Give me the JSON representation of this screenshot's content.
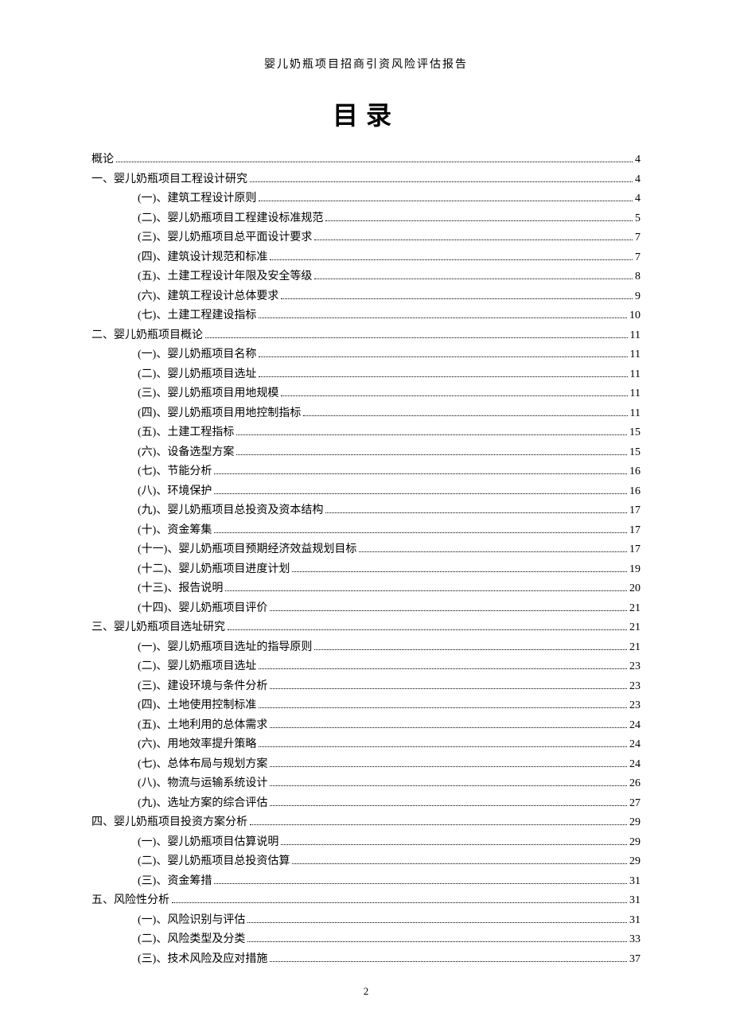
{
  "header": "婴儿奶瓶项目招商引资风险评估报告",
  "title": "目录",
  "page_number": "2",
  "toc": [
    {
      "level": 0,
      "label": "概论",
      "page": "4"
    },
    {
      "level": 1,
      "label": "一、婴儿奶瓶项目工程设计研究",
      "page": "4"
    },
    {
      "level": 2,
      "label": "(一)、建筑工程设计原则",
      "page": "4"
    },
    {
      "level": 2,
      "label": "(二)、婴儿奶瓶项目工程建设标准规范",
      "page": "5"
    },
    {
      "level": 2,
      "label": "(三)、婴儿奶瓶项目总平面设计要求",
      "page": "7"
    },
    {
      "level": 2,
      "label": "(四)、建筑设计规范和标准",
      "page": "7"
    },
    {
      "level": 2,
      "label": "(五)、土建工程设计年限及安全等级",
      "page": "8"
    },
    {
      "level": 2,
      "label": "(六)、建筑工程设计总体要求",
      "page": "9"
    },
    {
      "level": 2,
      "label": "(七)、土建工程建设指标",
      "page": "10"
    },
    {
      "level": 1,
      "label": "二、婴儿奶瓶项目概论",
      "page": "11"
    },
    {
      "level": 2,
      "label": "(一)、婴儿奶瓶项目名称",
      "page": "11"
    },
    {
      "level": 2,
      "label": "(二)、婴儿奶瓶项目选址",
      "page": "11"
    },
    {
      "level": 2,
      "label": "(三)、婴儿奶瓶项目用地规模",
      "page": "11"
    },
    {
      "level": 2,
      "label": "(四)、婴儿奶瓶项目用地控制指标",
      "page": "11"
    },
    {
      "level": 2,
      "label": "(五)、土建工程指标",
      "page": "15"
    },
    {
      "level": 2,
      "label": "(六)、设备选型方案",
      "page": "15"
    },
    {
      "level": 2,
      "label": "(七)、节能分析",
      "page": "16"
    },
    {
      "level": 2,
      "label": "(八)、环境保护",
      "page": "16"
    },
    {
      "level": 2,
      "label": "(九)、婴儿奶瓶项目总投资及资本结构",
      "page": "17"
    },
    {
      "level": 2,
      "label": "(十)、资金筹集",
      "page": "17"
    },
    {
      "level": 2,
      "label": "(十一)、婴儿奶瓶项目预期经济效益规划目标",
      "page": "17"
    },
    {
      "level": 2,
      "label": "(十二)、婴儿奶瓶项目进度计划",
      "page": "19"
    },
    {
      "level": 2,
      "label": "(十三)、报告说明",
      "page": "20"
    },
    {
      "level": 2,
      "label": "(十四)、婴儿奶瓶项目评价",
      "page": "21"
    },
    {
      "level": 1,
      "label": "三、婴儿奶瓶项目选址研究",
      "page": "21"
    },
    {
      "level": 2,
      "label": "(一)、婴儿奶瓶项目选址的指导原则",
      "page": "21"
    },
    {
      "level": 2,
      "label": "(二)、婴儿奶瓶项目选址",
      "page": "23"
    },
    {
      "level": 2,
      "label": "(三)、建设环境与条件分析",
      "page": "23"
    },
    {
      "level": 2,
      "label": "(四)、土地使用控制标准",
      "page": "23"
    },
    {
      "level": 2,
      "label": "(五)、土地利用的总体需求",
      "page": "24"
    },
    {
      "level": 2,
      "label": "(六)、用地效率提升策略",
      "page": "24"
    },
    {
      "level": 2,
      "label": "(七)、总体布局与规划方案",
      "page": "24"
    },
    {
      "level": 2,
      "label": "(八)、物流与运输系统设计",
      "page": "26"
    },
    {
      "level": 2,
      "label": "(九)、选址方案的综合评估",
      "page": "27"
    },
    {
      "level": 1,
      "label": "四、婴儿奶瓶项目投资方案分析",
      "page": "29"
    },
    {
      "level": 2,
      "label": "(一)、婴儿奶瓶项目估算说明",
      "page": "29"
    },
    {
      "level": 2,
      "label": "(二)、婴儿奶瓶项目总投资估算",
      "page": "29"
    },
    {
      "level": 2,
      "label": "(三)、资金筹措",
      "page": "31"
    },
    {
      "level": 1,
      "label": "五、风险性分析",
      "page": "31"
    },
    {
      "level": 2,
      "label": "(一)、风险识别与评估",
      "page": "31"
    },
    {
      "level": 2,
      "label": "(二)、风险类型及分类",
      "page": "33"
    },
    {
      "level": 2,
      "label": "(三)、技术风险及应对措施",
      "page": "37"
    }
  ]
}
